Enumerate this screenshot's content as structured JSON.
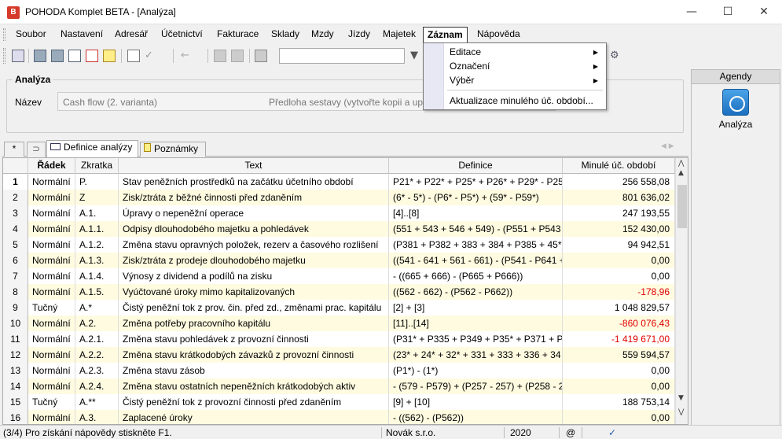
{
  "window": {
    "title": "POHODA Komplet BETA - [Analýza]",
    "app_badge": "B"
  },
  "menu": {
    "items": [
      "Soubor",
      "Nastavení",
      "Adresář",
      "Účetnictví",
      "Fakturace",
      "Sklady",
      "Mzdy",
      "Jízdy",
      "Majetek",
      "Záznam",
      "Nápověda"
    ],
    "active": "Záznam"
  },
  "dropdown": {
    "items": [
      {
        "label": "Editace",
        "submenu": true
      },
      {
        "label": "Označení",
        "submenu": true
      },
      {
        "label": "Výběr",
        "submenu": true
      },
      {
        "label": "Aktualizace minulého úč. období...",
        "submenu": false
      }
    ]
  },
  "analyza": {
    "legend": "Analýza",
    "nazev_label": "Název",
    "nazev_value": "Cash flow (2. varianta)",
    "nazev_note": "Předloha sestavy (vytvořte kopii a upr"
  },
  "agendy": {
    "title": "Agendy",
    "item_label": "Analýza"
  },
  "tabs": {
    "star": "*",
    "definice": "Definice analýzy",
    "poznamky": "Poznámky"
  },
  "grid": {
    "columns": [
      "",
      "Řádek",
      "Zkratka",
      "Text",
      "Definice",
      "Minulé úč. období"
    ],
    "rows": [
      {
        "n": "1",
        "radek": "Normální",
        "zkratka": "P.",
        "text": "Stav peněžních prostředků na začátku účetního období",
        "definice": "P21* + P22* + P25* + P26* + P29* - P25",
        "value": "256 558,08",
        "neg": false
      },
      {
        "n": "2",
        "radek": "Normální",
        "zkratka": "Z",
        "text": "Zisk/ztráta z běžné činnosti před zdaněním",
        "definice": "(6* - 5*) - (P6* - P5*) + (59* - P59*)",
        "value": "801 636,02",
        "neg": false
      },
      {
        "n": "3",
        "radek": "Normální",
        "zkratka": "A.1.",
        "text": "Úpravy o nepeněžní operace",
        "definice": "[4]..[8]",
        "value": "247 193,55",
        "neg": false
      },
      {
        "n": "4",
        "radek": "Normální",
        "zkratka": "A.1.1.",
        "text": "Odpisy dlouhodobého majetku a pohledávek",
        "definice": "(551 + 543 + 546 + 549) - (P551 + P543",
        "value": "152 430,00",
        "neg": false
      },
      {
        "n": "5",
        "radek": "Normální",
        "zkratka": "A.1.2.",
        "text": "Změna stavu opravných položek, rezerv a časového rozlišení",
        "definice": "(P381 + P382 + 383 + 384 + P385 + 45*)",
        "value": "94 942,51",
        "neg": false
      },
      {
        "n": "6",
        "radek": "Normální",
        "zkratka": "A.1.3.",
        "text": "Zisk/ztráta z prodeje dlouhodobého majetku",
        "definice": "((541 - 641 + 561 - 661) - (P541 - P641 +",
        "value": "0,00",
        "neg": false
      },
      {
        "n": "7",
        "radek": "Normální",
        "zkratka": "A.1.4.",
        "text": "Výnosy z dividend a podílů na zisku",
        "definice": " - ((665 + 666) - (P665 + P666))",
        "value": "0,00",
        "neg": false
      },
      {
        "n": "8",
        "radek": "Normální",
        "zkratka": "A.1.5.",
        "text": "Vyúčtované úroky mimo kapitalizovaných",
        "definice": "((562 - 662) - (P562 - P662))",
        "value": "-178,96",
        "neg": true
      },
      {
        "n": "9",
        "radek": "Tučný",
        "zkratka": "A.*",
        "text": "Čistý peněžní tok z prov. čin. před zd., změnami prac. kapitálu",
        "definice": "[2] + [3]",
        "value": "1 048 829,57",
        "neg": false
      },
      {
        "n": "10",
        "radek": "Normální",
        "zkratka": "A.2.",
        "text": "Změna potřeby pracovního kapitálu",
        "definice": "[11]..[14]",
        "value": "-860 076,43",
        "neg": true
      },
      {
        "n": "11",
        "radek": "Normální",
        "zkratka": "A.2.1.",
        "text": "Změna stavu pohledávek z provozní činnosti",
        "definice": "(P31* + P335 + P349 + P35* + P371 + P",
        "value": "-1 419 671,00",
        "neg": true
      },
      {
        "n": "12",
        "radek": "Normální",
        "zkratka": "A.2.2.",
        "text": "Změna stavu krátkodobých závazků z provozní činnosti",
        "definice": "(23* + 24* + 32* + 331 + 333 + 336 + 34",
        "value": "559 594,57",
        "neg": false
      },
      {
        "n": "13",
        "radek": "Normální",
        "zkratka": "A.2.3.",
        "text": "Změna stavu zásob",
        "definice": "(P1*) - (1*)",
        "value": "0,00",
        "neg": false
      },
      {
        "n": "14",
        "radek": "Normální",
        "zkratka": "A.2.4.",
        "text": "Změna stavu ostatních nepeněžních krátkodobých aktiv",
        "definice": " - (579 - P579) + (P257 - 257) + (P258 - 2",
        "value": "0,00",
        "neg": false
      },
      {
        "n": "15",
        "radek": "Tučný",
        "zkratka": "A.**",
        "text": "Čistý peněžní tok z provozní činnosti před zdaněním",
        "definice": "[9] + [10]",
        "value": "188 753,14",
        "neg": false
      },
      {
        "n": "16",
        "radek": "Normální",
        "zkratka": "A.3.",
        "text": "Zaplacené úroky",
        "definice": " - ((562) - (P562))",
        "value": "0,00",
        "neg": false
      }
    ]
  },
  "status": {
    "help": "(3/4) Pro získání nápovědy stiskněte F1.",
    "company": "Novák s.r.o.",
    "year": "2020",
    "at": "@"
  },
  "colors": {
    "alt_row": "#fffbe0",
    "negative": "#e00000",
    "selected_row_num": "#ffffff"
  }
}
